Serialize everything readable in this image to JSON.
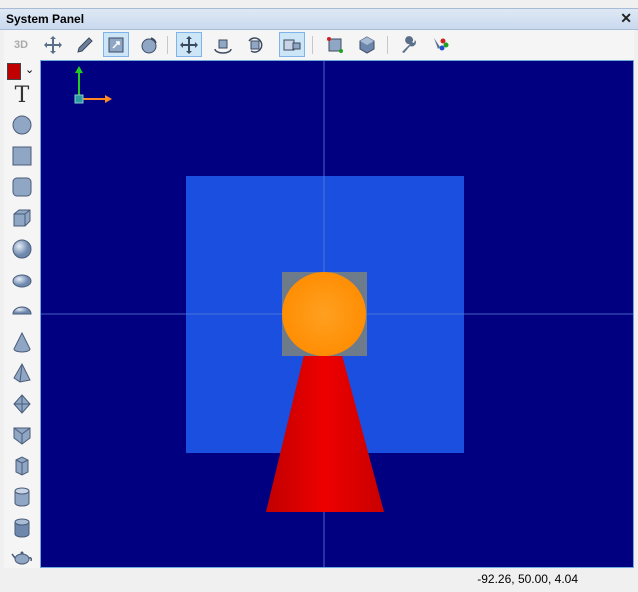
{
  "window": {
    "title": "System Panel"
  },
  "toolbar": {
    "label_3d": "3D",
    "buttons": [
      {
        "icon": "move-arrows-icon"
      },
      {
        "icon": "pencil-icon"
      },
      {
        "icon": "zoom-window-icon",
        "active": true
      },
      {
        "icon": "rotate-view-icon"
      },
      {
        "icon": "pan-icon",
        "active": true
      },
      {
        "icon": "orbit-icon"
      },
      {
        "icon": "rotate-object-icon"
      },
      {
        "icon": "select-mode-icon",
        "active": true
      },
      {
        "icon": "render-icon"
      },
      {
        "icon": "cube-shade-icon"
      },
      {
        "icon": "wrench-icon"
      },
      {
        "icon": "paint-tools-icon"
      }
    ]
  },
  "left_tools": {
    "color": "#c00000",
    "text_tool": "T",
    "items": [
      "circle-icon",
      "square-icon",
      "rounded-square-icon",
      "cube-icon",
      "sphere-icon",
      "ellipsoid-icon",
      "half-ellipsoid-icon",
      "cone-icon",
      "pyramid-icon",
      "octahedron-icon",
      "prism-icon",
      "hex-cylinder-icon",
      "cylinder-icon",
      "capped-cylinder-icon",
      "teapot-icon"
    ]
  },
  "viewport": {
    "background": "#000080",
    "plane_color": "#1a4fe0",
    "box_color": "#6e7b8b",
    "sphere_color": "#ff9c10",
    "cone_color": "#e00000"
  },
  "status": {
    "coordinates": "-92.26, 50.00, 4.04"
  }
}
